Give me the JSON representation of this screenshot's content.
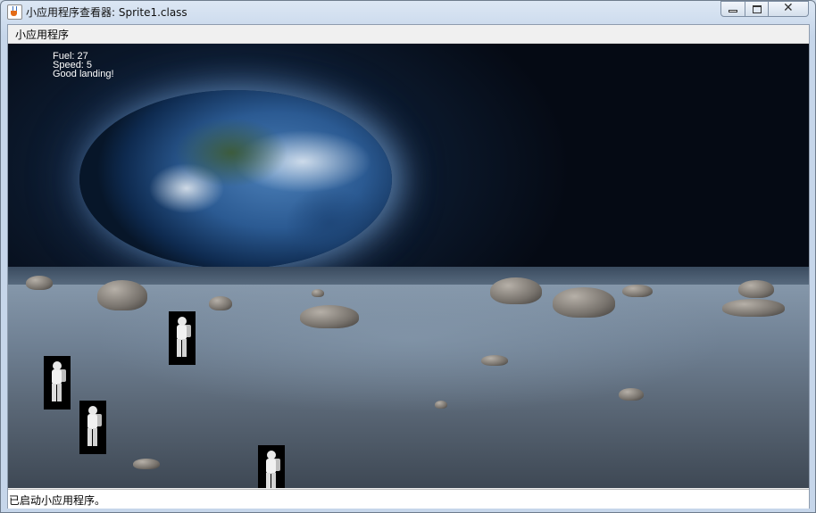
{
  "window": {
    "title": "小应用程序查看器: Sprite1.class",
    "icon": "java-cup-icon",
    "controls": {
      "minimize_icon": "minimize-icon",
      "maximize_icon": "maximize-icon",
      "close_icon": "close-icon"
    }
  },
  "menubar": {
    "menu_label": "小应用程序"
  },
  "hud": {
    "fuel": "Fuel: 27",
    "speed": "Speed: 5",
    "message": "Good landing!"
  },
  "sprites": {
    "icon": "astronaut-icon",
    "count": 4
  },
  "statusbar": {
    "text": "已启动小应用程序。"
  },
  "colors": {
    "hud_text": "#ffffff",
    "sky": "#050a14",
    "ground": "#6f8093"
  }
}
